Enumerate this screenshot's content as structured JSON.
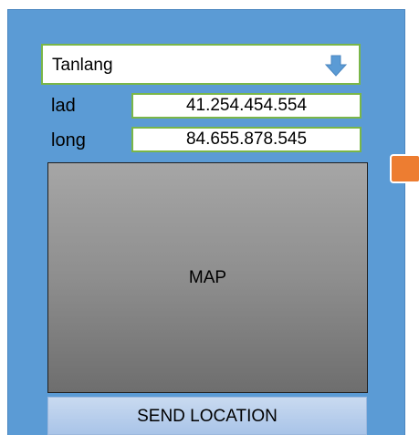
{
  "location_select": {
    "value": "Tanlang",
    "icon": "arrow-down-icon"
  },
  "fields": {
    "lat": {
      "label": "lad",
      "value": "41.254.454.554"
    },
    "long": {
      "label": "long",
      "value": "84.655.878.545"
    }
  },
  "map": {
    "label": "MAP"
  },
  "send_button": {
    "label": "SEND LOCATION"
  },
  "colors": {
    "panel": "#5b9bd5",
    "field_border": "#7ab648",
    "dropdown_arrow": "#5b9bd5",
    "side_handle": "#ed7d31",
    "button": "#b4cdec"
  }
}
